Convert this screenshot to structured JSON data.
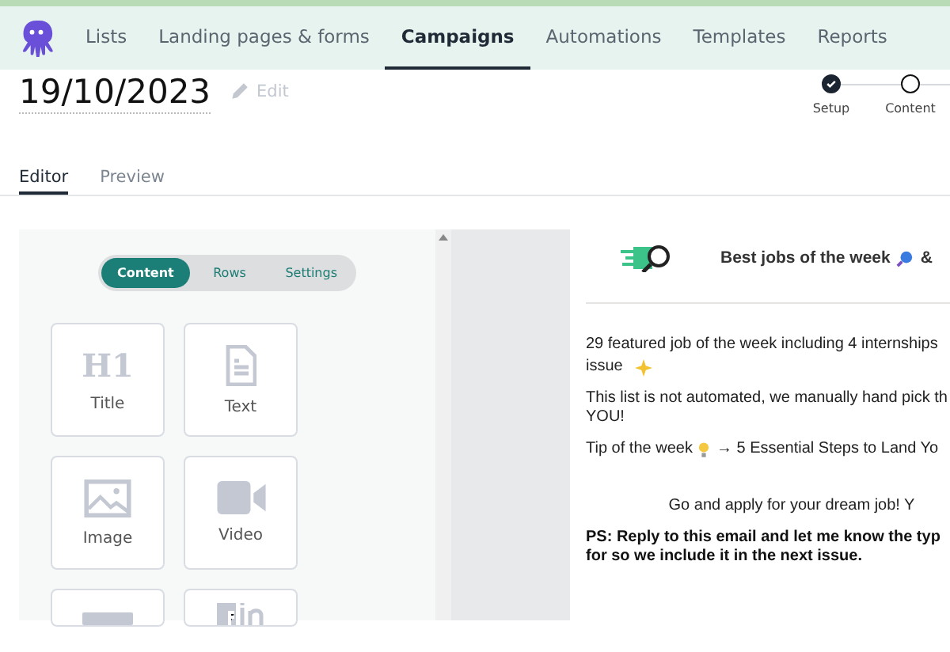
{
  "nav": {
    "items": [
      {
        "label": "Lists",
        "selected": false
      },
      {
        "label": "Landing pages & forms",
        "selected": false
      },
      {
        "label": "Campaigns",
        "selected": true
      },
      {
        "label": "Automations",
        "selected": false
      },
      {
        "label": "Templates",
        "selected": false
      },
      {
        "label": "Reports",
        "selected": false
      }
    ]
  },
  "campaign": {
    "title": "19/10/2023",
    "edit_label": "Edit"
  },
  "steps": [
    {
      "label": "Setup",
      "done": true
    },
    {
      "label": "Content",
      "done": false
    }
  ],
  "tabs": [
    {
      "label": "Editor",
      "selected": true
    },
    {
      "label": "Preview",
      "selected": false
    }
  ],
  "panel": {
    "segments": [
      {
        "label": "Content",
        "selected": true
      },
      {
        "label": "Rows",
        "selected": false
      },
      {
        "label": "Settings",
        "selected": false
      }
    ],
    "blocks": [
      {
        "kind": "title",
        "label": "Title",
        "glyph": "H1"
      },
      {
        "kind": "text",
        "label": "Text"
      },
      {
        "kind": "image",
        "label": "Image"
      },
      {
        "kind": "video",
        "label": "Video"
      },
      {
        "kind": "button"
      },
      {
        "kind": "social"
      }
    ]
  },
  "email": {
    "heading": "Best jobs of the week",
    "heading_tail": "&",
    "paragraphs": [
      {
        "kind": "plain",
        "lines": [
          "29 featured job of the week including 4 internships"
        ]
      },
      {
        "kind": "sparkle",
        "lines": [
          "issue"
        ]
      },
      {
        "kind": "plain",
        "lines": [
          "This list is not automated, we manually hand pick th",
          "YOU!"
        ]
      },
      {
        "kind": "tip",
        "lines": [
          "Tip of the week",
          "→  5 Essential Steps to Land Yo"
        ]
      },
      {
        "kind": "center",
        "lines": [
          "Go and apply for your dream job! Y"
        ]
      },
      {
        "kind": "bold",
        "lines": [
          "PS: Reply to this email and let me know the typ",
          "for so we include it in the next issue."
        ]
      }
    ]
  }
}
